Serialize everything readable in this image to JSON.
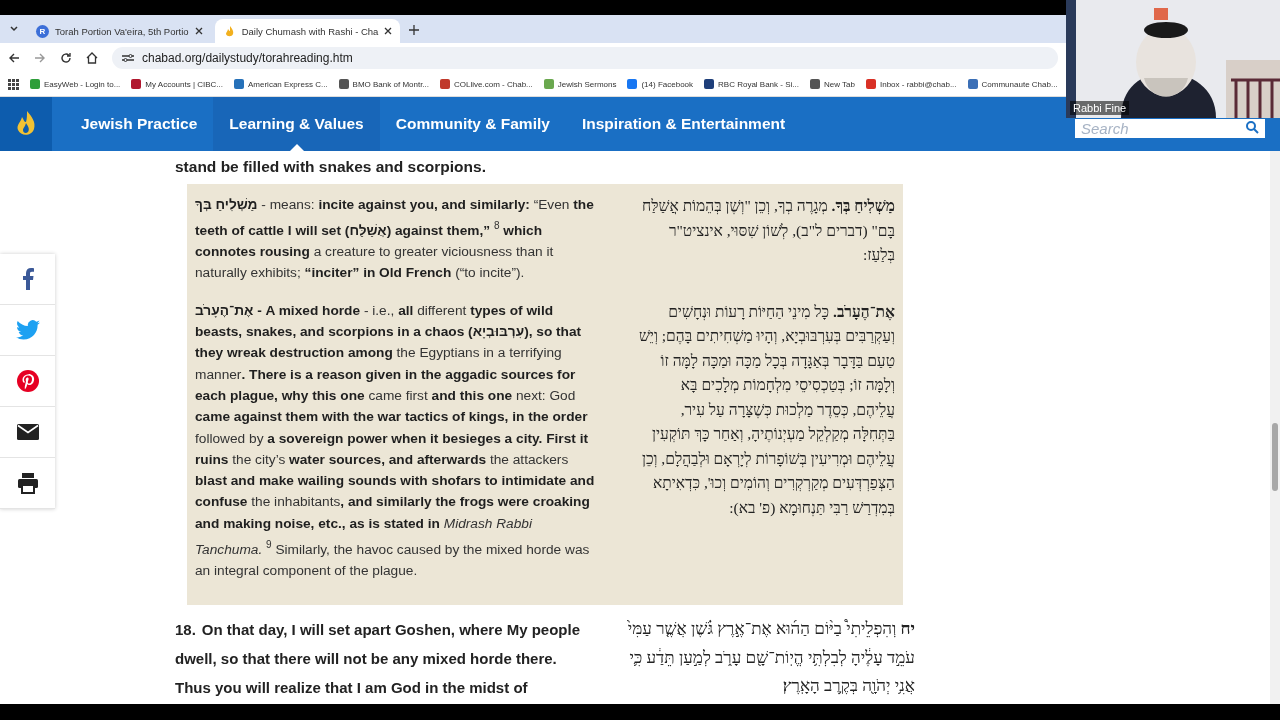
{
  "browser": {
    "tabs": [
      {
        "title": "Torah Portion Va'eira, 5th Portio",
        "selected": false,
        "favicon_letter": "R"
      },
      {
        "title": "Daily Chumash with Rashi - Cha",
        "selected": true
      }
    ],
    "address": "chabad.org/dailystudy/torahreading.htm",
    "bookmarks": [
      {
        "label": "EasyWeb - Login to...",
        "color": "#2e9e3a"
      },
      {
        "label": "My Accounts | CIBC...",
        "color": "#b0172e"
      },
      {
        "label": "American Express C...",
        "color": "#2671b9"
      },
      {
        "label": "BMO Bank of Montr...",
        "color": "#555555"
      },
      {
        "label": "COLlive.com - Chab...",
        "color": "#c0392b"
      },
      {
        "label": "Jewish Sermons",
        "color": "#6aa84f"
      },
      {
        "label": "(14) Facebook",
        "color": "#1877f2"
      },
      {
        "label": "RBC Royal Bank - Si...",
        "color": "#1f3f7a"
      },
      {
        "label": "New Tab",
        "color": "#555555"
      },
      {
        "label": "Inbox - rabbi@chab...",
        "color": "#d93025"
      },
      {
        "label": "Communaute Chab...",
        "color": "#3b6fb6"
      }
    ]
  },
  "site_nav": {
    "items": [
      {
        "label": "Jewish Practice",
        "selected": false
      },
      {
        "label": "Learning & Values",
        "selected": true
      },
      {
        "label": "Community & Family",
        "selected": false
      },
      {
        "label": "Inspiration & Entertainment",
        "selected": false
      }
    ],
    "search": {
      "placeholder": "Search"
    }
  },
  "video": {
    "name": "Rabbi Fine"
  },
  "reading": {
    "lead": "**stand** be filled with snakes and scorpions.",
    "rashi": [
      {
        "english": "**מַשְׁלִיחַ בְּךָ** - means: **incite against you, and similarly:** “Even **the teeth of cattle I will set (אֲשַׁלַּח) against them,”** $^{8}$ **which connotes rousing** a creature to greater viciousness than it naturally exhibits; **“inciter” in Old French** (“to incite”).",
        "hebrew": "**מַשְׁלִיחַ בְּךָ.** מְגָרֶה בְךָ, וְכֵן \"וְשֶׁן בְּהֵמוֹת אֲשַׁלַּח בָּם\" (דברים ל\"ב), לְשׁוֹן שִׁסּוּי, אינציט\"ר בְּלַעַז:"
      },
      {
        "english": "**אֶת־הֶעָרֹב - A mixed horde** - i.e., **all** different **types of wild beasts, snakes, and scorpions in a chaos (עִרְבּוּבְיָא), so that they wreak destruction among** the Egyptians in a terrifying manner**. There is a reason given in the aggadic sources for each plague, why this one** came first **and this one** next: God **came against them with the war tactics of kings, in the order** followed by **a sovereign power when it besieges a city. First it ruins** the city’s **water sources, and afterwards** the attackers **blast and make wailing sounds with shofars to intimidate and confuse** the inhabitants**, and similarly the frogs were croaking and making noise, etc., as is stated in** *Midrash Rabbi Tanchuma.* $^{9}$ Similarly, the havoc caused by the mixed horde was an integral component of the plague.",
        "hebrew": "**אֶת־הֶעָרֹב.** כָּל מִינֵי הַחַיּוֹת רָעוֹת וּנְחָשִׁים וְעַקְרַבִּים בְּעִרְבּוּבְיָא, וְהָיוּ מַשְׁחִיתִים בָּהֶם; וְיֵשׁ טַעַם בַּדָּבָר בְּאַגָּדָה בְּכָל מַכָּה וּמַכָּה לָמָּה זוֹ וְלָמָּה זוֹ; בְּטַכְסִיסֵי מִלְחָמוֹת מְלָכִים בָּא עֲלֵיהֶם, כְּסֵדֶר מַלְכוּת כְּשֶׁצָּרָה עַל עִיר, בַּתְּחִלָּה מְקַלְקֵל מַעְיְנוֹתֶיהָ, וְאַחַר כָּךְ תּוֹקְעִין עֲלֵיהֶם וּמְרִיעִין בְּשׁוֹפָרוֹת לְיָרְאָם וּלְבַהֲלָם, וְכֵן הַצְּפַרְדְּעִים מְקַרְקְרִים וְהוֹמִים וְכוּ', כִּדְאִיתָא בְּמִדְרַשׁ רַבִּי תַּנְחוּמָא (פ' בא):"
      }
    ],
    "verses": [
      {
        "number": "18.",
        "english": "On that day, I will set apart Goshen, where My people dwell, so that there will not be any mixed horde there. Thus you will realize that I am God in the midst of",
        "hebrew_number": "יח",
        "hebrew": "וְהִפְלֵיתִי֩ בַיּ֨וֹם הַה֜וּא אֶת־אֶ֣רֶץ גֹּ֗שֶׁן אֲשֶׁ֤ר עַמִּי֙ עֹמֵ֣ד עָלֶ֔יהָ לְבִלְתִּ֥י הֱיֽוֹת־שָׁ֖ם עָרֹ֑ב לְמַ֣עַן תֵּדַ֔ע כִּ֛י אֲנִ֥י יְהֹוָ֖ה בְּקֶ֥רֶב הָאָֽרֶץ׃"
      }
    ]
  }
}
